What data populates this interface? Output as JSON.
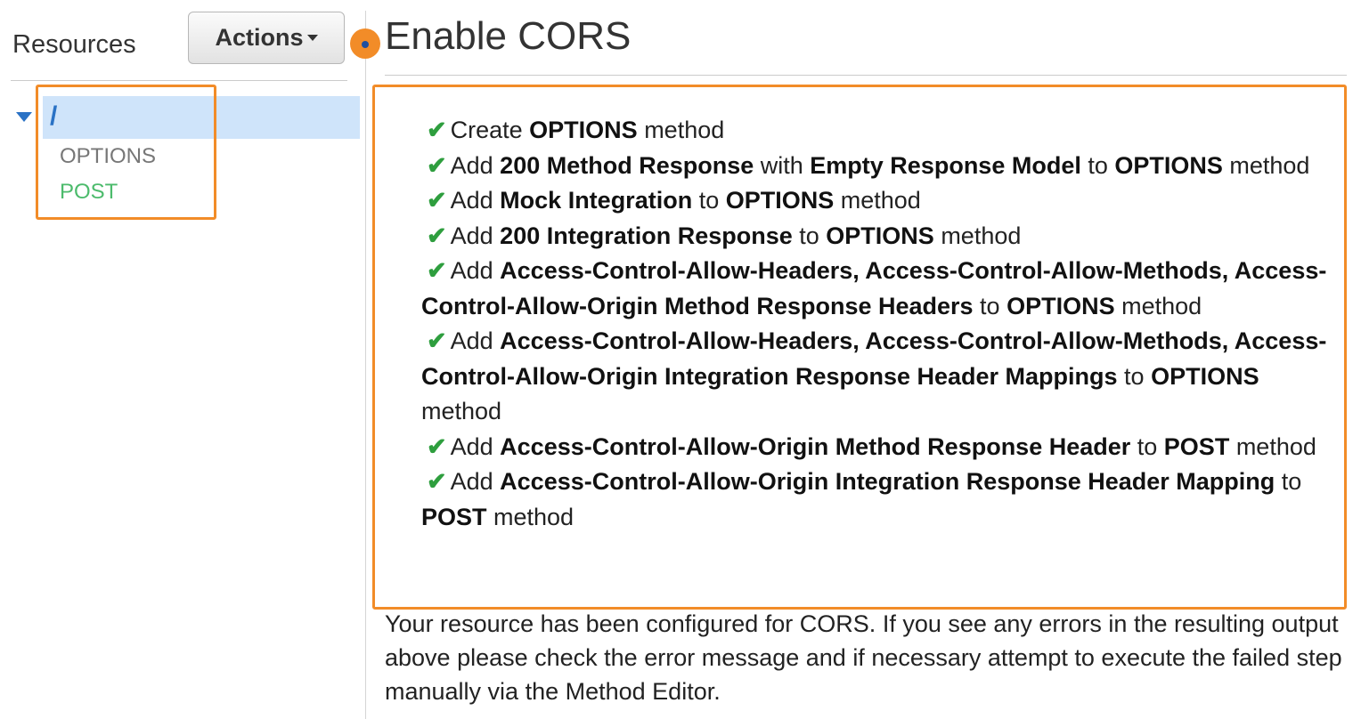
{
  "sidebar": {
    "title": "Resources",
    "actions_label": "Actions",
    "tree": {
      "root": "/",
      "methods": [
        "OPTIONS",
        "POST"
      ]
    }
  },
  "main": {
    "title": "Enable CORS",
    "check_glyph": "✔",
    "steps": [
      [
        "Create ",
        "OPTIONS",
        " method"
      ],
      [
        "Add ",
        "200 Method Response",
        " with ",
        "Empty Response Model",
        " to ",
        "OPTIONS",
        " method"
      ],
      [
        "Add ",
        "Mock Integration",
        " to ",
        "OPTIONS",
        " method"
      ],
      [
        "Add ",
        "200 Integration Response",
        " to ",
        "OPTIONS",
        " method"
      ],
      [
        "Add ",
        "Access-Control-Allow-Headers, Access-Control-Allow-Methods, Access-Control-Allow-Origin Method Response Headers",
        " to ",
        "OPTIONS",
        " method"
      ],
      [
        "Add ",
        "Access-Control-Allow-Headers, Access-Control-Allow-Methods, Access-Control-Allow-Origin Integration Response Header Mappings",
        " to ",
        "OPTIONS",
        " method"
      ],
      [
        "Add ",
        "Access-Control-Allow-Origin Method Response Header",
        " to ",
        "POST",
        " method"
      ],
      [
        "Add ",
        "Access-Control-Allow-Origin Integration Response Header Mapping",
        " to ",
        "POST",
        " method"
      ]
    ],
    "summary": "Your resource has been configured for CORS. If you see any errors in the resulting output above please check the error message and if necessary attempt to execute the failed step manually via the Method Editor."
  },
  "colors": {
    "highlight": "#f28c28",
    "check": "#2e9e3e",
    "selected_row": "#cfe4fa",
    "post_method": "#4cbb6c",
    "link_blue": "#2a72c5"
  }
}
